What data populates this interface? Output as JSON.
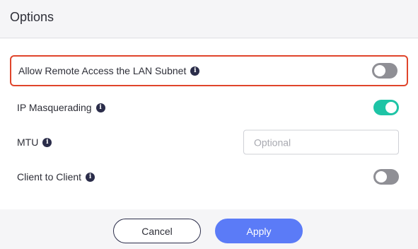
{
  "header": {
    "title": "Options"
  },
  "options": {
    "remote_access": {
      "label": "Allow Remote Access the LAN Subnet",
      "enabled": false
    },
    "ip_masquerading": {
      "label": "IP Masquerading",
      "enabled": true
    },
    "mtu": {
      "label": "MTU",
      "value": "",
      "placeholder": "Optional"
    },
    "client_to_client": {
      "label": "Client to Client",
      "enabled": false
    }
  },
  "icons": {
    "info": "info-icon"
  },
  "colors": {
    "toggle_on": "#1ec4a6",
    "toggle_off": "#8f8f95",
    "apply_button": "#5b7bf7",
    "highlight_border": "#e0452b"
  },
  "footer": {
    "cancel_label": "Cancel",
    "apply_label": "Apply"
  }
}
